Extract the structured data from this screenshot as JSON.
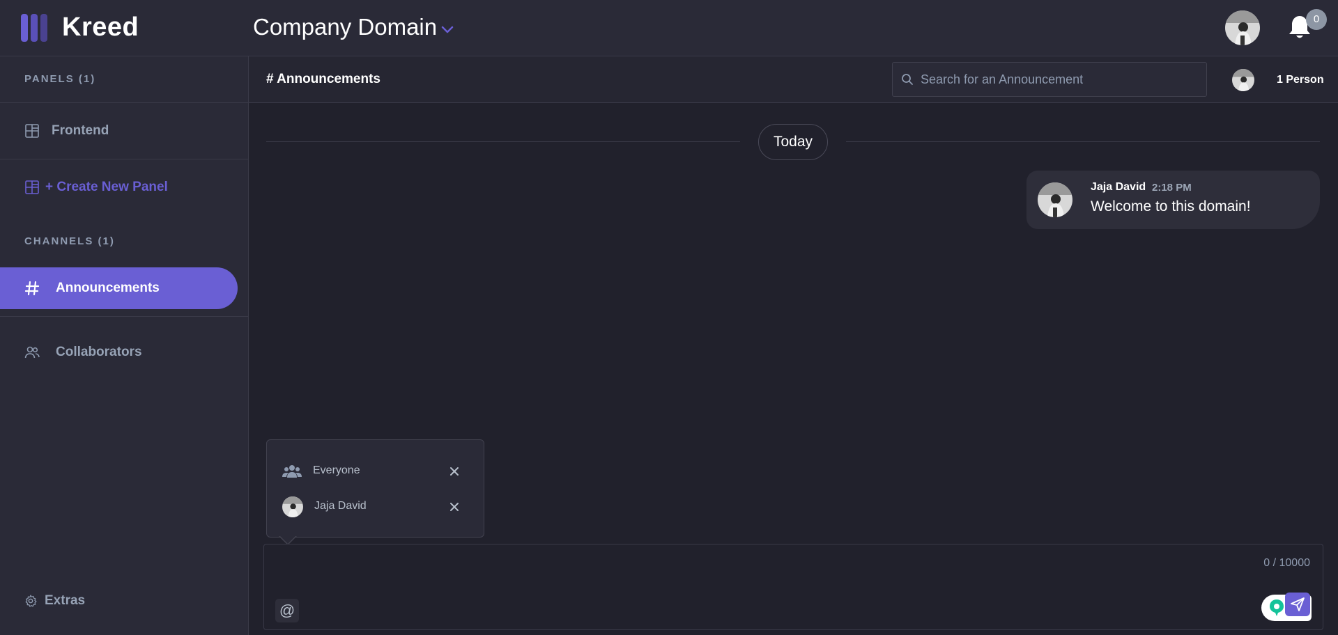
{
  "app": {
    "name": "Kreed",
    "domain": "Company Domain",
    "notifications_count": "0"
  },
  "sidebar": {
    "panels_label": "PANELS (1)",
    "panels": [
      {
        "label": "Frontend"
      }
    ],
    "create_panel_label": "+ Create New Panel",
    "channels_label": "CHANNELS (1)",
    "channels": [
      {
        "label": "Announcements",
        "active": true
      }
    ],
    "collaborators_label": "Collaborators",
    "extras_label": "Extras"
  },
  "channel": {
    "title": "# Announcements",
    "search_placeholder": "Search for an Announcement",
    "members_label": "1 Person"
  },
  "messages": {
    "day_separator": "Today",
    "items": [
      {
        "author": "Jaja David",
        "time": "2:18 PM",
        "text": "Welcome to this domain!"
      }
    ]
  },
  "mentions": {
    "items": [
      {
        "label": "Everyone",
        "icon": "group-icon"
      },
      {
        "label": "Jaja David",
        "icon": "avatar"
      }
    ]
  },
  "composer": {
    "char_count": "0 / 10000",
    "at_label": "@"
  },
  "colors": {
    "accent": "#6a5fd4",
    "background": "#21212c",
    "surface": "#2a2a37"
  }
}
